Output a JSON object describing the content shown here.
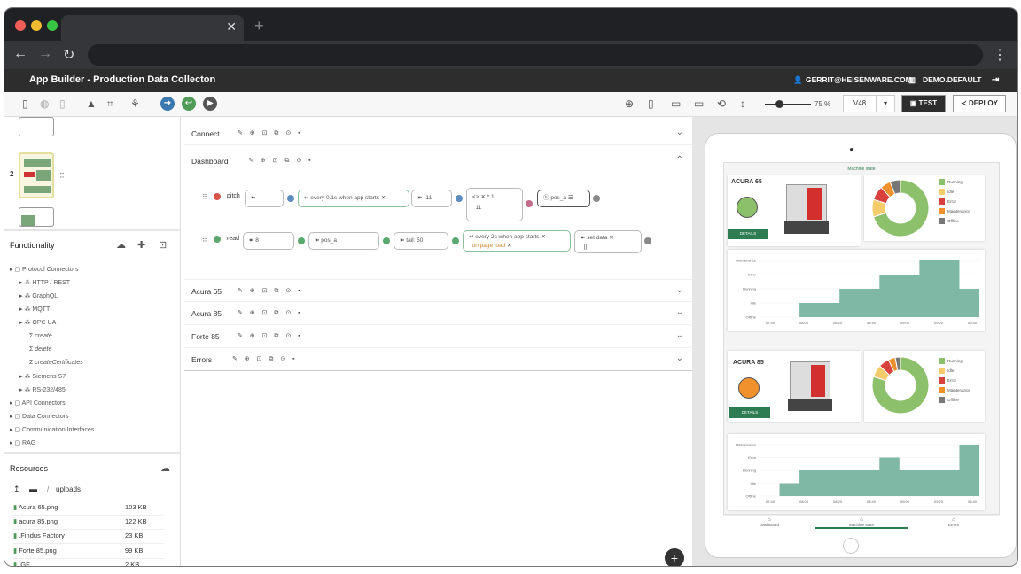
{
  "app": {
    "title": "App Builder - Production Data Collecton",
    "user": "GERRIT@HEISENWARE.COM",
    "org": "DEMO.DEFAULT"
  },
  "toolbar": {
    "zoom": "75 %",
    "version": "V48",
    "test_label": "TEST",
    "deploy_label": "DEPLOY"
  },
  "thumbnails": {
    "page_number": "2"
  },
  "functionality": {
    "title": "Functionality",
    "tree": [
      {
        "label": "Protocol Connectors",
        "level": 0
      },
      {
        "label": "HTTP / REST",
        "level": 1
      },
      {
        "label": "GraphQL",
        "level": 1
      },
      {
        "label": "MQTT",
        "level": 1
      },
      {
        "label": "OPC UA",
        "level": 1
      },
      {
        "label": "create",
        "level": 2
      },
      {
        "label": "delete",
        "level": 2
      },
      {
        "label": "createCertificates",
        "level": 2
      },
      {
        "label": "Siemens S7",
        "level": 1
      },
      {
        "label": "RS-232/485",
        "level": 1
      },
      {
        "label": "API Connectors",
        "level": 0
      },
      {
        "label": "Data Connectors",
        "level": 0
      },
      {
        "label": "Communication Interfaces",
        "level": 0
      },
      {
        "label": "RAG",
        "level": 0
      }
    ]
  },
  "resources": {
    "title": "Resources",
    "path_sep": "/",
    "path": "uploads",
    "files": [
      {
        "name": "Acura 65.png",
        "size": "103 KB"
      },
      {
        "name": "acura 85.png",
        "size": "122 KB"
      },
      {
        "name": ".Findus Factory",
        "size": "23 KB"
      },
      {
        "name": "Forte 85.png",
        "size": "99 KB"
      },
      {
        "name": ".GF",
        "size": "2 KB"
      }
    ]
  },
  "sections": {
    "connect": "Connect",
    "dashboard": "Dashboard",
    "acura65": "Acura 65",
    "acura85": "Acura 85",
    "forte85": "Forte 85",
    "errors": "Errors"
  },
  "flow": {
    "pitch": {
      "label": "pitch",
      "trigger": "every 0.1s when app starts",
      "value": "-11",
      "op": "*",
      "num": "1",
      "num2": "11",
      "var": "pos_a"
    },
    "read": {
      "label": "read",
      "var1": "8",
      "var2": "pos_a",
      "tail": "tail: 50",
      "trigger": "every 2s when app starts",
      "trigger2": "on page load",
      "set": "set",
      "set_var": "data",
      "brackets": "[]"
    }
  },
  "preview": {
    "header": "Machine state",
    "m1": {
      "name": "ACURA 65",
      "details": "DETAILS",
      "status_color": "#8dc06a"
    },
    "m2": {
      "name": "ACURA 85",
      "details": "DETAILS",
      "status_color": "#f0912d"
    },
    "legend": [
      "Running",
      "Idle",
      "Error",
      "Maintenance",
      "Offline"
    ],
    "legend_colors": [
      "#8dc06a",
      "#f5cc6c",
      "#d9413c",
      "#f0912d",
      "#777777"
    ],
    "pie1": [
      0.7,
      0.1,
      0.08,
      0.06,
      0.06
    ],
    "pie2": [
      0.8,
      0.07,
      0.06,
      0.04,
      0.03
    ],
    "ylabels": [
      "Maintenance",
      "Error",
      "Running",
      "Idle",
      "Offline"
    ],
    "xlabels1": [
      "07:40",
      "08:00",
      "08:20",
      "08:40",
      "09:00",
      "09:20",
      "09:40"
    ],
    "xlabels2": [
      "07:40",
      "08:00",
      "08:20",
      "08:40",
      "09:00",
      "09:20",
      "09:40"
    ],
    "tabs": [
      "Dashboard",
      "Machine state",
      "Errors"
    ]
  }
}
